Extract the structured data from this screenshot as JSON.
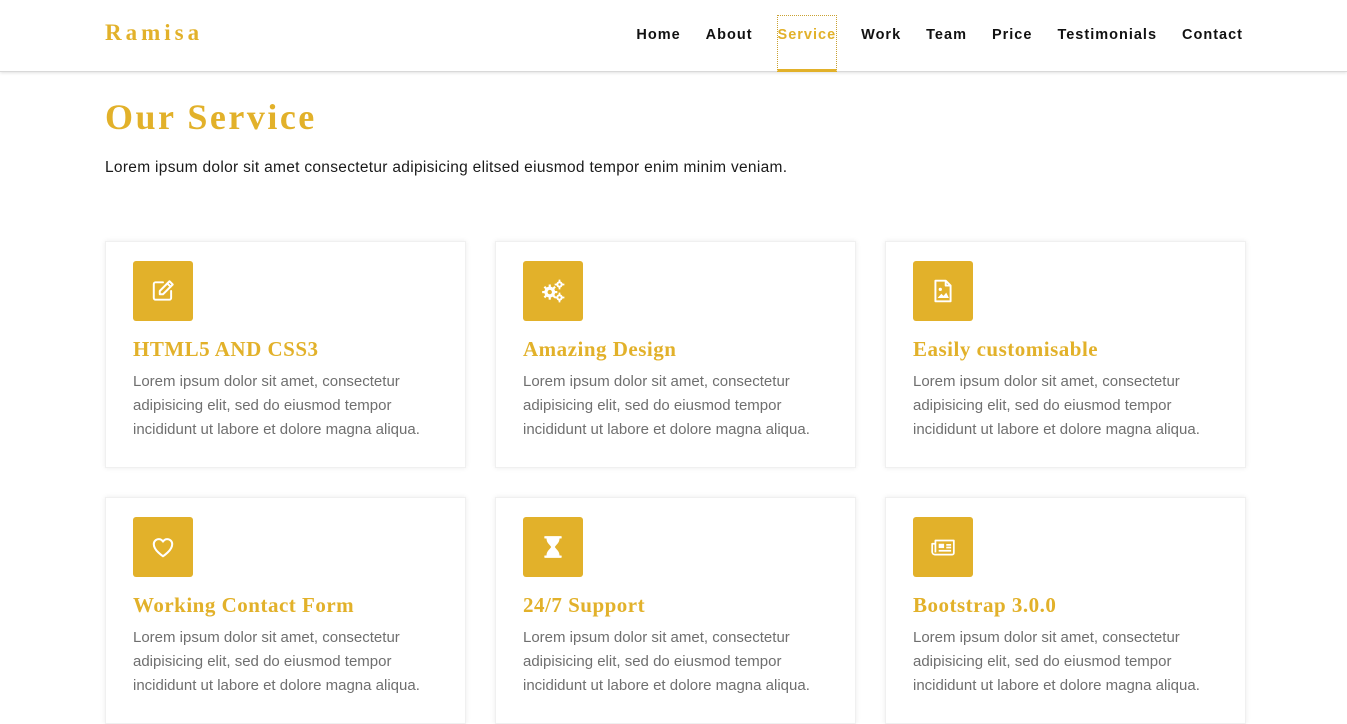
{
  "brand": "Ramisa",
  "nav": {
    "items": [
      {
        "label": "Home"
      },
      {
        "label": "About"
      },
      {
        "label": "Service"
      },
      {
        "label": "Work"
      },
      {
        "label": "Team"
      },
      {
        "label": "Price"
      },
      {
        "label": "Testimonials"
      },
      {
        "label": "Contact"
      }
    ],
    "active": "Service"
  },
  "section": {
    "title": "Our Service",
    "description": "Lorem ipsum dolor sit amet consectetur adipisicing elitsed eiusmod tempor enim minim veniam."
  },
  "colors": {
    "accent": "#e2b12a",
    "text": "#1a1a1a",
    "muted": "#6f6f6f"
  },
  "services": [
    {
      "icon": "edit-icon",
      "title": "HTML5 AND CSS3",
      "text": "Lorem ipsum dolor sit amet, consectetur adipisicing elit, sed do eiusmod tempor incididunt ut labore et dolore magna aliqua."
    },
    {
      "icon": "gears-icon",
      "title": "Amazing Design",
      "text": "Lorem ipsum dolor sit amet, consectetur adipisicing elit, sed do eiusmod tempor incididunt ut labore et dolore magna aliqua."
    },
    {
      "icon": "image-file-icon",
      "title": "Easily customisable",
      "text": "Lorem ipsum dolor sit amet, consectetur adipisicing elit, sed do eiusmod tempor incididunt ut labore et dolore magna aliqua."
    },
    {
      "icon": "heart-icon",
      "title": "Working Contact Form",
      "text": "Lorem ipsum dolor sit amet, consectetur adipisicing elit, sed do eiusmod tempor incididunt ut labore et dolore magna aliqua."
    },
    {
      "icon": "hourglass-icon",
      "title": "24/7 Support",
      "text": "Lorem ipsum dolor sit amet, consectetur adipisicing elit, sed do eiusmod tempor incididunt ut labore et dolore magna aliqua."
    },
    {
      "icon": "newspaper-icon",
      "title": "Bootstrap 3.0.0",
      "text": "Lorem ipsum dolor sit amet, consectetur adipisicing elit, sed do eiusmod tempor incididunt ut labore et dolore magna aliqua."
    }
  ]
}
